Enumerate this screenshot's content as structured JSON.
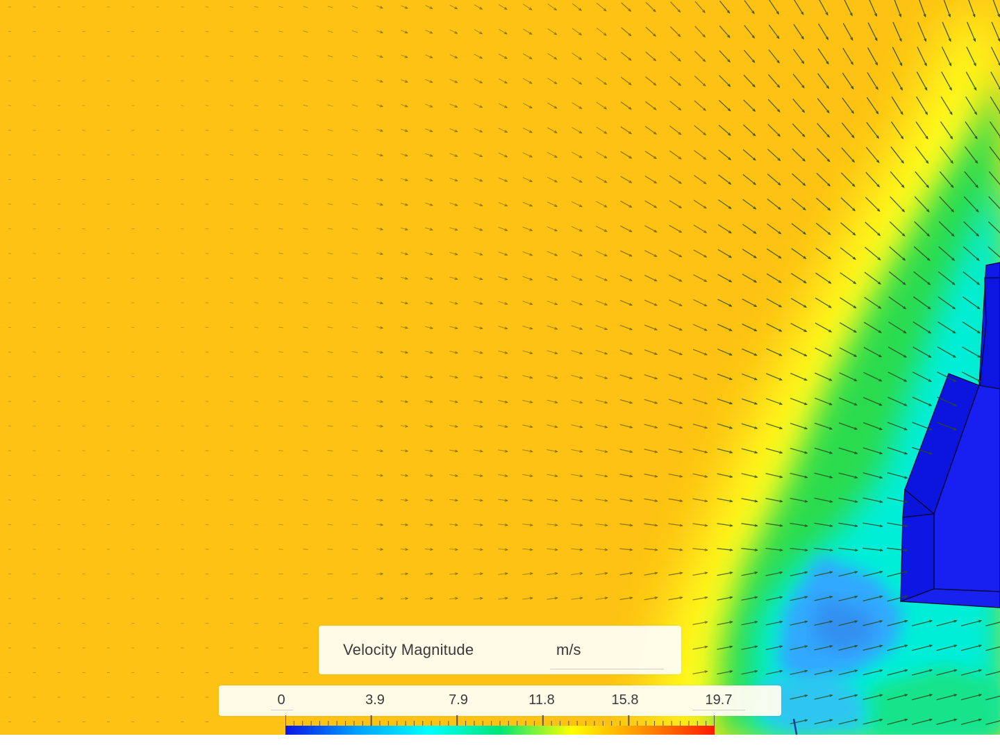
{
  "legend": {
    "title": "Velocity Magnitude",
    "unit": "m/s",
    "ticks": [
      "0",
      "3.9",
      "7.9",
      "11.8",
      "15.8",
      "19.7"
    ],
    "range": [
      0,
      19.7
    ]
  },
  "colors": {
    "background_field": "#fdc213",
    "obstacle": "#0a14e6",
    "colormap": [
      "#0a14e6",
      "#00a0ff",
      "#00ffff",
      "#00e676",
      "#ffff00",
      "#ff9000",
      "#ff1a00"
    ]
  },
  "icons": {
    "vectors": "arrow-glyph"
  }
}
